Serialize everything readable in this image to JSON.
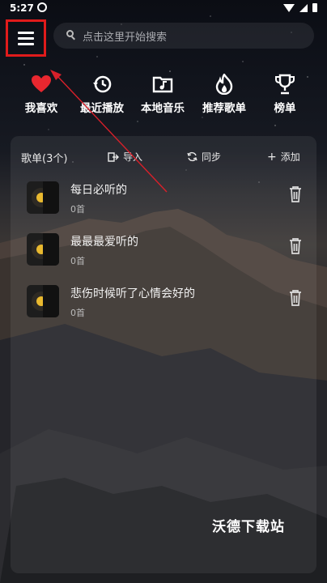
{
  "status_bar": {
    "time": "5:27"
  },
  "search": {
    "placeholder": "点击这里开始搜索"
  },
  "quick_nav": [
    {
      "label": "我喜欢",
      "icon": "heart-icon"
    },
    {
      "label": "最近播放",
      "icon": "history-icon"
    },
    {
      "label": "本地音乐",
      "icon": "folder-music-icon"
    },
    {
      "label": "推荐歌单",
      "icon": "flame-icon"
    },
    {
      "label": "榜单",
      "icon": "trophy-icon"
    }
  ],
  "playlists": {
    "title": "歌单(3个)",
    "actions": {
      "import": "导入",
      "sync": "同步",
      "add": "添加"
    },
    "items": [
      {
        "name": "每日必听的",
        "count": "0首"
      },
      {
        "name": "最最最爱听的",
        "count": "0首"
      },
      {
        "name": "悲伤时候听了心情会好的",
        "count": "0首"
      }
    ]
  },
  "watermark": "沃德下载站",
  "colors": {
    "highlight": "#e01b1b",
    "heart": "#e8272f"
  }
}
